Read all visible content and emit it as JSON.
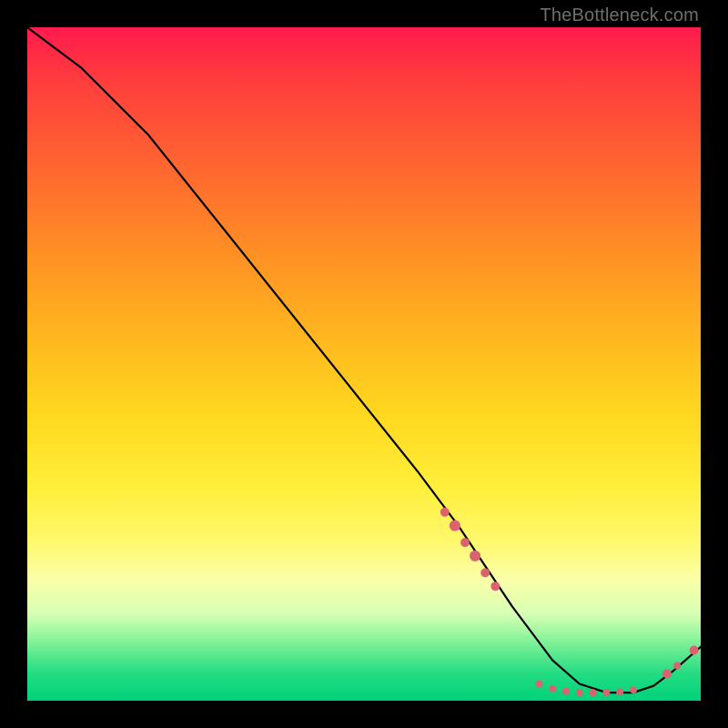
{
  "watermark": "TheBottleneck.com",
  "chart_data": {
    "type": "line",
    "title": "",
    "xlabel": "",
    "ylabel": "",
    "xlim": [
      0,
      100
    ],
    "ylim": [
      0,
      100
    ],
    "curve": {
      "name": "bottleneck-curve",
      "x": [
        0,
        4,
        8,
        12,
        18,
        26,
        34,
        42,
        50,
        58,
        64,
        68,
        72,
        75,
        78,
        82,
        86,
        90,
        93,
        96,
        100
      ],
      "y": [
        100,
        97,
        94,
        90,
        84,
        74,
        64,
        54,
        44,
        34,
        26,
        20,
        14,
        10,
        6,
        2.5,
        1.2,
        1.2,
        2.2,
        4.5,
        8
      ]
    },
    "markers": {
      "name": "selected-points",
      "points": [
        {
          "x": 62,
          "y": 28,
          "r": 5
        },
        {
          "x": 63.5,
          "y": 26,
          "r": 6
        },
        {
          "x": 65,
          "y": 23.5,
          "r": 5
        },
        {
          "x": 66.5,
          "y": 21.5,
          "r": 6
        },
        {
          "x": 68,
          "y": 19,
          "r": 5
        },
        {
          "x": 69.5,
          "y": 17,
          "r": 5
        },
        {
          "x": 76,
          "y": 2.5,
          "r": 4
        },
        {
          "x": 78,
          "y": 1.8,
          "r": 4
        },
        {
          "x": 80,
          "y": 1.4,
          "r": 4
        },
        {
          "x": 82,
          "y": 1.2,
          "r": 4
        },
        {
          "x": 84,
          "y": 1.2,
          "r": 4
        },
        {
          "x": 86,
          "y": 1.2,
          "r": 4
        },
        {
          "x": 88,
          "y": 1.3,
          "r": 4
        },
        {
          "x": 90,
          "y": 1.6,
          "r": 4
        },
        {
          "x": 95,
          "y": 4.0,
          "r": 5
        },
        {
          "x": 96.5,
          "y": 5.2,
          "r": 4
        },
        {
          "x": 99,
          "y": 7.5,
          "r": 5
        }
      ]
    },
    "gradient_stops": [
      {
        "pos": 0,
        "color": "#ff1a4d"
      },
      {
        "pos": 22,
        "color": "#ff6a2f"
      },
      {
        "pos": 46,
        "color": "#ffb71f"
      },
      {
        "pos": 68,
        "color": "#ffee3a"
      },
      {
        "pos": 90,
        "color": "#9cf7a0"
      },
      {
        "pos": 100,
        "color": "#00d27a"
      }
    ]
  }
}
